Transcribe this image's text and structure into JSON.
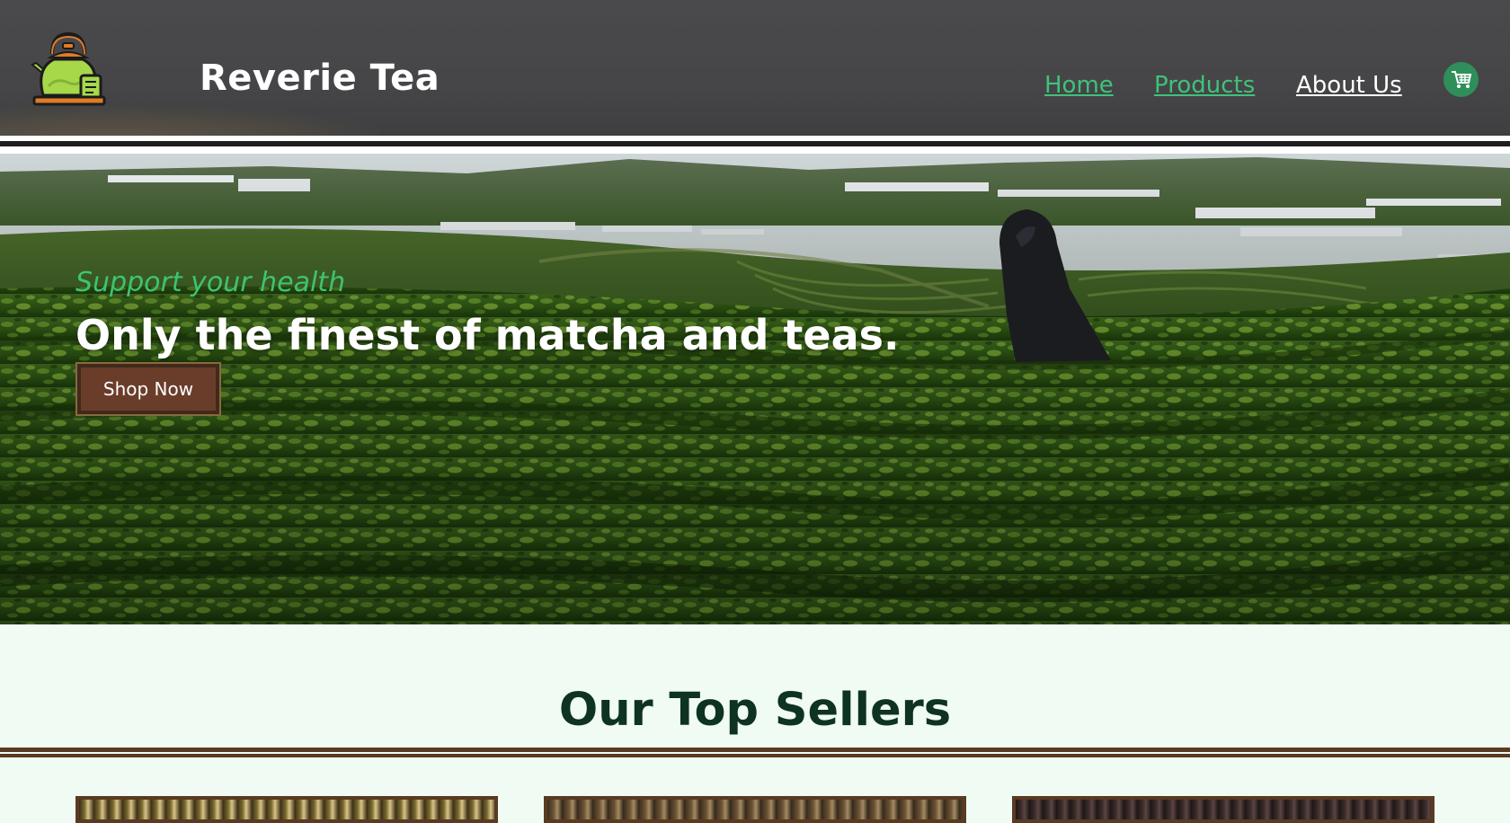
{
  "header": {
    "brand": "Reverie Tea",
    "logo_icon": "teapot-icon",
    "nav": [
      {
        "label": "Home",
        "color": "#3fc27a"
      },
      {
        "label": "Products",
        "color": "#3fc27a"
      },
      {
        "label": "About Us",
        "color": "#ffffff"
      }
    ],
    "cart_icon": "shopping-cart-icon"
  },
  "hero": {
    "tagline": "Support your health",
    "headline": "Only the finest of matcha and teas.",
    "cta_label": "Shop Now"
  },
  "top_sellers": {
    "title": "Our Top Sellers",
    "cards": [
      {
        "image": "dried-chamomile-tea"
      },
      {
        "image": "dried-herbal-tea"
      },
      {
        "image": "dried-black-tea"
      }
    ]
  },
  "colors": {
    "accent_green": "#3fc27a",
    "dark_green": "#0e3320",
    "brown": "#6a3d2a",
    "page_bg": "#f0fbf3"
  }
}
